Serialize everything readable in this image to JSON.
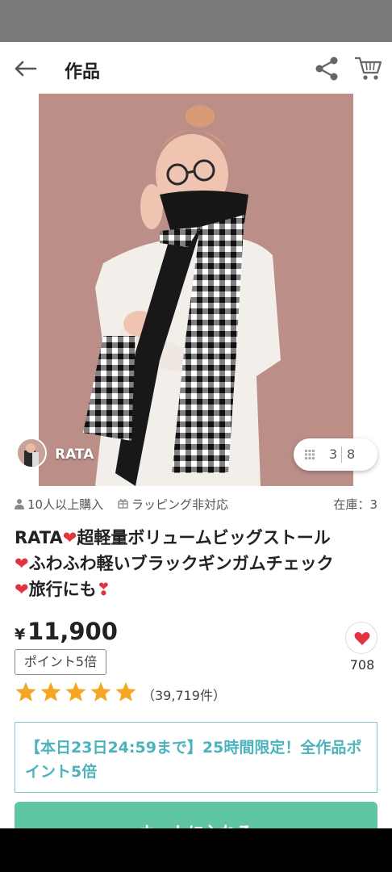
{
  "app_bar": {
    "title": "作品",
    "back_icon": "arrow-left-icon",
    "share_icon": "share-icon",
    "cart_icon": "cart-icon"
  },
  "gallery": {
    "shop_name": "RATA",
    "current_image": "3",
    "total_images": "8"
  },
  "meta": {
    "purchase_text": "10人以上購入",
    "wrapping_text": "ラッピング非対応",
    "stock_text": "在庫：3"
  },
  "product": {
    "title_part1": "RATA",
    "title_part2": "超軽量ボリュームビッグストール",
    "title_part3": "ふわふわ軽いブラックギンガムチェック",
    "title_part4": "旅行にも",
    "currency": "¥",
    "price": "11,900",
    "points_badge": "ポイント5倍",
    "favorite_count": "708",
    "rating_stars": 5,
    "review_count": "（39,719件）"
  },
  "campaign": {
    "text": "【本日23日24:59まで】25時間限定！全作品ポイント5倍"
  },
  "cart_button": {
    "label": "カートに入れる"
  },
  "colors": {
    "accent_teal": "#4cb3bd",
    "button_green": "#5fc6a3",
    "heart_red": "#e0343f",
    "star_orange": "#f5a623"
  }
}
